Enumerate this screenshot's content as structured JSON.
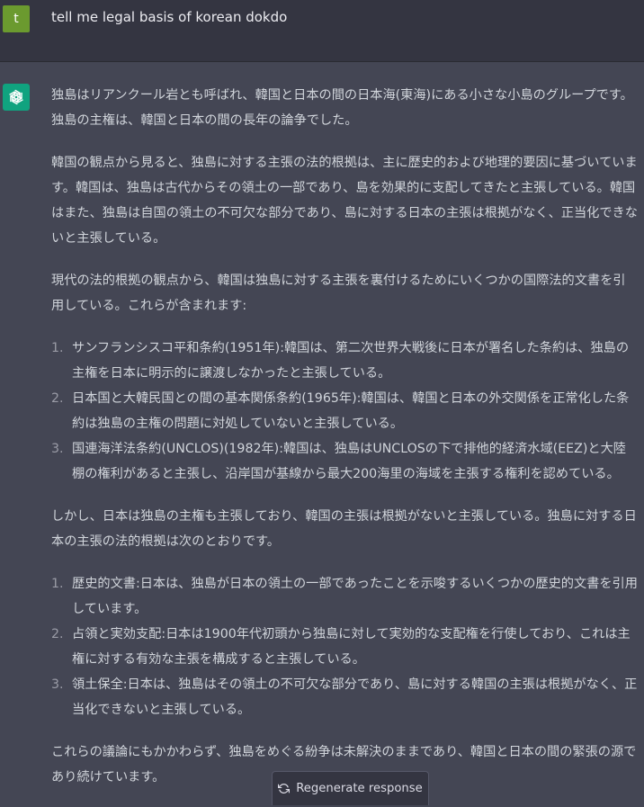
{
  "user": {
    "avatar_letter": "t",
    "message": "tell me legal basis of korean dokdo"
  },
  "assistant": {
    "avatar_icon": "openai-logo-icon",
    "p1": "独島はリアンクール岩とも呼ばれ、韓国と日本の間の日本海(東海)にある小さな小島のグループです。独島の主権は、韓国と日本の間の長年の論争でした。",
    "p2": "韓国の観点から見ると、独島に対する主張の法的根拠は、主に歴史的および地理的要因に基づいています。韓国は、独島は古代からその領土の一部であり、島を効果的に支配してきたと主張している。韓国はまた、独島は自国の領土の不可欠な部分であり、島に対する日本の主張は根拠がなく、正当化できないと主張している。",
    "p3": "現代の法的根拠の観点から、韓国は独島に対する主張を裏付けるためにいくつかの国際法的文書を引用している。これらが含まれます:",
    "list1": [
      {
        "num": "1.",
        "text": "サンフランシスコ平和条約(1951年):韓国は、第二次世界大戦後に日本が署名した条約は、独島の主権を日本に明示的に譲渡しなかったと主張している。"
      },
      {
        "num": "2.",
        "text": "日本国と大韓民国との間の基本関係条約(1965年):韓国は、韓国と日本の外交関係を正常化した条約は独島の主権の問題に対処していないと主張している。"
      },
      {
        "num": "3.",
        "text": "国連海洋法条約(UNCLOS)(1982年):韓国は、独島はUNCLOSの下で排他的経済水域(EEZ)と大陸棚の権利があると主張し、沿岸国が基線から最大200海里の海域を主張する権利を認めている。"
      }
    ],
    "p4": "しかし、日本は独島の主権も主張しており、韓国の主張は根拠がないと主張している。独島に対する日本の主張の法的根拠は次のとおりです。",
    "list2": [
      {
        "num": "1.",
        "text": "歴史的文書:日本は、独島が日本の領土の一部であったことを示唆するいくつかの歴史的文書を引用しています。"
      },
      {
        "num": "2.",
        "text": "占領と実効支配:日本は1900年代初頭から独島に対して実効的な支配権を行使しており、これは主権に対する有効な主張を構成すると主張している。"
      },
      {
        "num": "3.",
        "text": "領土保全:日本は、独島はその領土の不可欠な部分であり、島に対する韓国の主張は根拠がなく、正当化できないと主張している。"
      }
    ],
    "p5": "これらの議論にもかかわらず、独島をめぐる紛争は未解決のままであり、韓国と日本の間の緊張の源であり続けています。"
  },
  "regenerate": {
    "label": "Regenerate response",
    "icon": "refresh-icon"
  },
  "colors": {
    "user_bg": "#343541",
    "assistant_bg": "#444654",
    "user_avatar": "#6b9a2f",
    "gpt_avatar": "#10a37f",
    "text": "#d1d5db"
  }
}
